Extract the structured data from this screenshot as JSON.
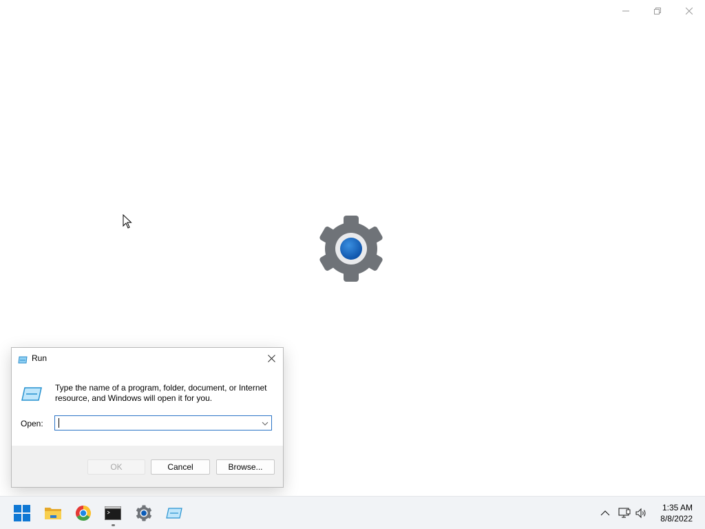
{
  "window": {
    "controls": [
      "minimize-icon",
      "restore-icon",
      "close-icon"
    ],
    "splash_icon": "settings-gear-icon"
  },
  "run_dialog": {
    "title": "Run",
    "description": "Type the name of a program, folder, document, or Internet resource, and Windows will open it for you.",
    "open_label": "Open:",
    "open_value": "",
    "buttons": {
      "ok": "OK",
      "cancel": "Cancel",
      "browse": "Browse..."
    },
    "ok_disabled": true
  },
  "taskbar": {
    "pinned": [
      "start-button",
      "file-explorer",
      "chrome",
      "command-prompt",
      "settings",
      "run"
    ],
    "tray": [
      "chevron-up-icon",
      "network-icon",
      "volume-icon"
    ],
    "time": "1:35 AM",
    "date": "8/8/2022"
  },
  "colors": {
    "accent": "#0067c0",
    "focus_border": "#2a73c6",
    "taskbar_bg": "#f1f3f6"
  }
}
